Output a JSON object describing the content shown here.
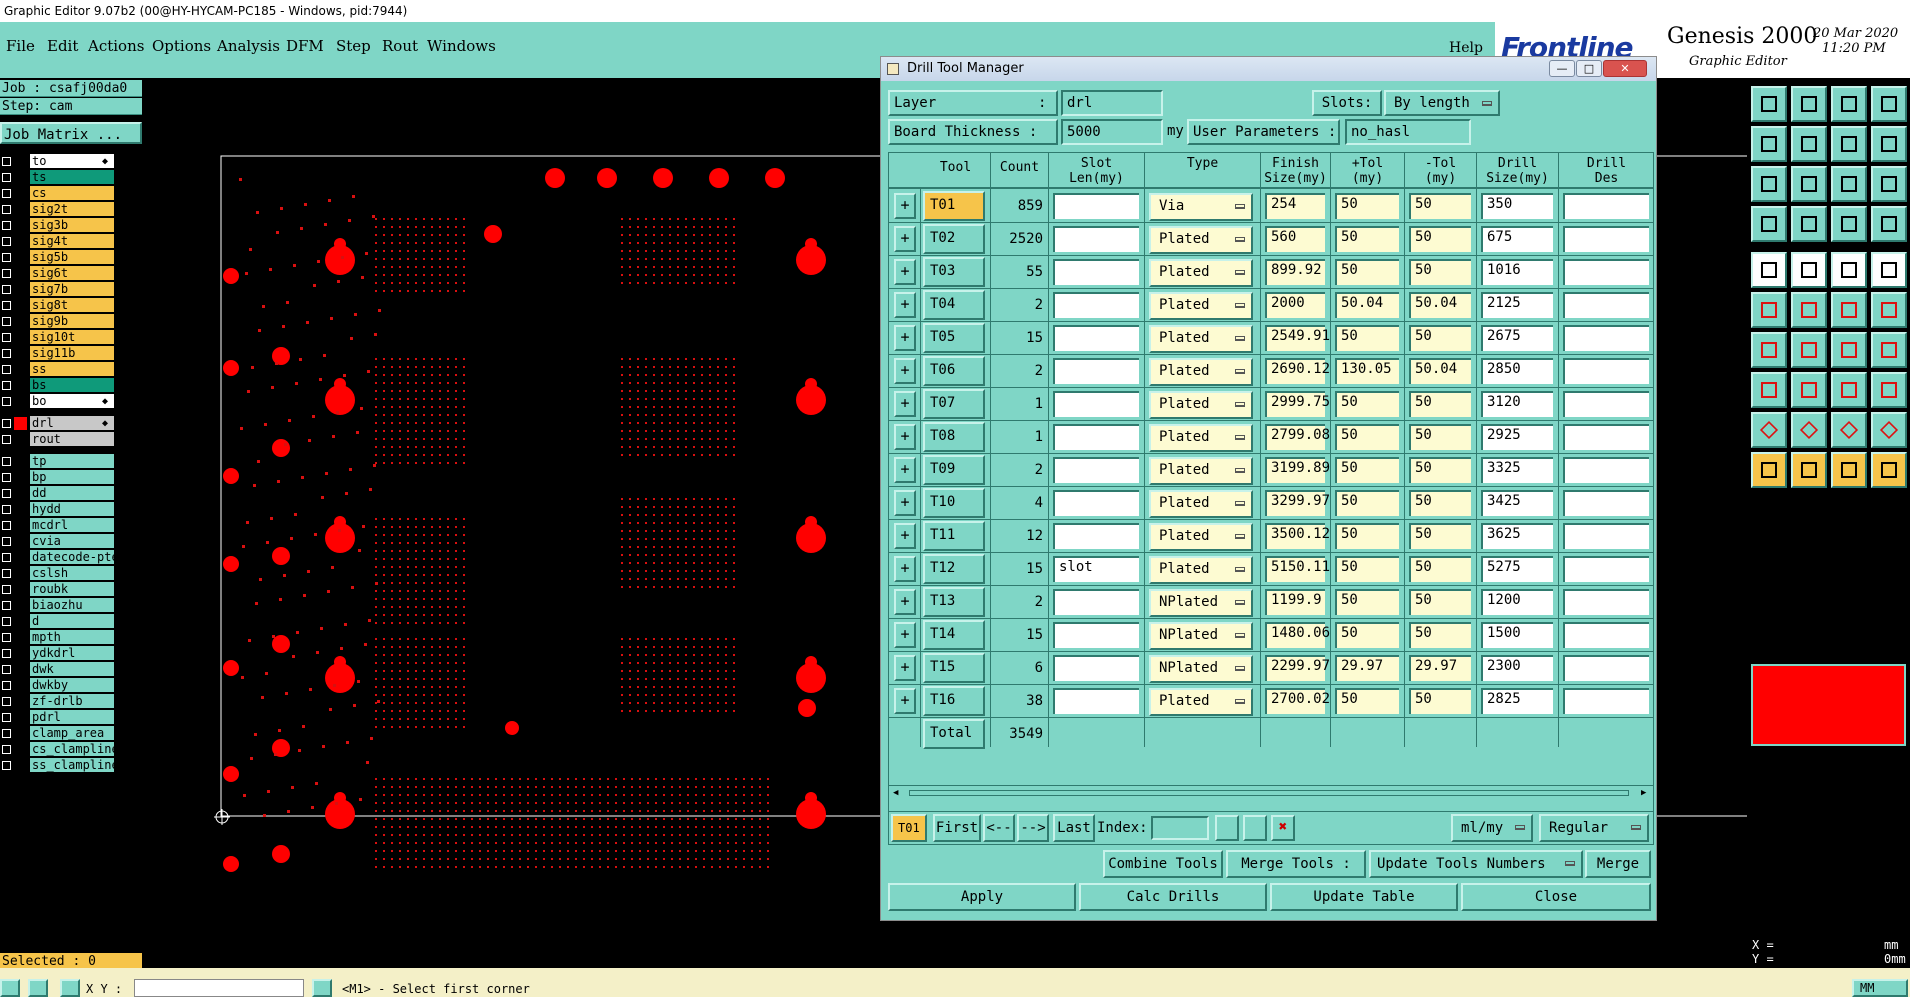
{
  "window": {
    "title": "Graphic Editor 9.07b2 (00@HY-HYCAM-PC185 - Windows, pid:7944)"
  },
  "menu": {
    "items": [
      "File",
      "Edit",
      "Actions",
      "Options",
      "Analysis",
      "DFM",
      "Step",
      "Rout",
      "Windows"
    ],
    "help": "Help"
  },
  "brand": {
    "logo": "Frontline",
    "product": "Genesis 2000",
    "subtitle": "Graphic Editor",
    "date": "20 Mar 2020",
    "time": "11:20 PM"
  },
  "job": {
    "job": "Job : csafj00da0",
    "step": "Step: cam",
    "matrix": "Job Matrix ..."
  },
  "layers_top": [
    {
      "name": "to",
      "bg": "#ffffff"
    },
    {
      "name": "ts",
      "bg": "#0f9a7a"
    },
    {
      "name": "cs",
      "bg": "#f6c44a"
    },
    {
      "name": "sig2t",
      "bg": "#f6c44a"
    },
    {
      "name": "sig3b",
      "bg": "#f6c44a"
    },
    {
      "name": "sig4t",
      "bg": "#f6c44a"
    },
    {
      "name": "sig5b",
      "bg": "#f6c44a"
    },
    {
      "name": "sig6t",
      "bg": "#f6c44a"
    },
    {
      "name": "sig7b",
      "bg": "#f6c44a"
    },
    {
      "name": "sig8t",
      "bg": "#f6c44a"
    },
    {
      "name": "sig9b",
      "bg": "#f6c44a"
    },
    {
      "name": "sig10t",
      "bg": "#f6c44a"
    },
    {
      "name": "sig11b",
      "bg": "#f6c44a"
    },
    {
      "name": "ss",
      "bg": "#f6c44a"
    },
    {
      "name": "bs",
      "bg": "#0f9a7a"
    },
    {
      "name": "bo",
      "bg": "#ffffff"
    }
  ],
  "layers_drill": [
    {
      "name": "drl",
      "bg": "#c8c8c8"
    },
    {
      "name": "rout",
      "bg": "#c8c8c8"
    }
  ],
  "layers_misc": [
    "tp",
    "bp",
    "dd",
    "hydd",
    "mcdrl",
    "cvia",
    "datecode-pte",
    "cslsh",
    "roubk",
    "biaozhu",
    "d",
    "mpth",
    "ydkdrl",
    "dwk",
    "dwkby",
    "zf-drlb",
    "pdrl",
    "clamp_area",
    "cs_clampline",
    "ss_clampline"
  ],
  "selected": "Selected : 0",
  "dialog": {
    "title": "Drill Tool Manager",
    "layer_label": "Layer",
    "layer_colon": ":",
    "layer_value": "drl",
    "slots_label": "Slots:",
    "slots_value": "By length",
    "board_thickness_label": "Board Thickness :",
    "board_thickness_value": "5000",
    "board_thickness_unit": "my",
    "user_params_label": "User Parameters :",
    "user_params_value": "no_hasl",
    "columns": [
      "Tool",
      "Count",
      "Slot\nLen(my)",
      "Type",
      "Finish\nSize(my)",
      "+Tol\n(my)",
      "-Tol\n(my)",
      "Drill\nSize(my)",
      "Drill\nDes"
    ],
    "rows": [
      {
        "tool": "T01",
        "count": "859",
        "slot": "",
        "type": "Via",
        "finish": "254",
        "ptol": "50",
        "mtol": "50",
        "drill": "350",
        "des": ""
      },
      {
        "tool": "T02",
        "count": "2520",
        "slot": "",
        "type": "Plated",
        "finish": "560",
        "ptol": "50",
        "mtol": "50",
        "drill": "675",
        "des": ""
      },
      {
        "tool": "T03",
        "count": "55",
        "slot": "",
        "type": "Plated",
        "finish": "899.92",
        "ptol": "50",
        "mtol": "50",
        "drill": "1016",
        "des": ""
      },
      {
        "tool": "T04",
        "count": "2",
        "slot": "",
        "type": "Plated",
        "finish": "2000",
        "ptol": "50.04",
        "mtol": "50.04",
        "drill": "2125",
        "des": ""
      },
      {
        "tool": "T05",
        "count": "15",
        "slot": "",
        "type": "Plated",
        "finish": "2549.91",
        "ptol": "50",
        "mtol": "50",
        "drill": "2675",
        "des": ""
      },
      {
        "tool": "T06",
        "count": "2",
        "slot": "",
        "type": "Plated",
        "finish": "2690.12",
        "ptol": "130.05",
        "mtol": "50.04",
        "drill": "2850",
        "des": ""
      },
      {
        "tool": "T07",
        "count": "1",
        "slot": "",
        "type": "Plated",
        "finish": "2999.75",
        "ptol": "50",
        "mtol": "50",
        "drill": "3120",
        "des": ""
      },
      {
        "tool": "T08",
        "count": "1",
        "slot": "",
        "type": "Plated",
        "finish": "2799.08",
        "ptol": "50",
        "mtol": "50",
        "drill": "2925",
        "des": ""
      },
      {
        "tool": "T09",
        "count": "2",
        "slot": "",
        "type": "Plated",
        "finish": "3199.89",
        "ptol": "50",
        "mtol": "50",
        "drill": "3325",
        "des": ""
      },
      {
        "tool": "T10",
        "count": "4",
        "slot": "",
        "type": "Plated",
        "finish": "3299.97",
        "ptol": "50",
        "mtol": "50",
        "drill": "3425",
        "des": ""
      },
      {
        "tool": "T11",
        "count": "12",
        "slot": "",
        "type": "Plated",
        "finish": "3500.12",
        "ptol": "50",
        "mtol": "50",
        "drill": "3625",
        "des": ""
      },
      {
        "tool": "T12",
        "count": "15",
        "slot": "slot",
        "type": "Plated",
        "finish": "5150.11",
        "ptol": "50",
        "mtol": "50",
        "drill": "5275",
        "des": ""
      },
      {
        "tool": "T13",
        "count": "2",
        "slot": "",
        "type": "NPlated",
        "finish": "1199.9",
        "ptol": "50",
        "mtol": "50",
        "drill": "1200",
        "des": ""
      },
      {
        "tool": "T14",
        "count": "15",
        "slot": "",
        "type": "NPlated",
        "finish": "1480.06",
        "ptol": "50",
        "mtol": "50",
        "drill": "1500",
        "des": ""
      },
      {
        "tool": "T15",
        "count": "6",
        "slot": "",
        "type": "NPlated",
        "finish": "2299.97",
        "ptol": "29.97",
        "mtol": "29.97",
        "drill": "2300",
        "des": ""
      },
      {
        "tool": "T16",
        "count": "38",
        "slot": "",
        "type": "Plated",
        "finish": "2700.02",
        "ptol": "50",
        "mtol": "50",
        "drill": "2825",
        "des": ""
      }
    ],
    "total_label": "Total",
    "total_value": "3549",
    "nav": {
      "current": "T01",
      "first": "First",
      "prev": "<--",
      "next": "-->",
      "last": "Last",
      "index_label": "Index:",
      "units": "ml/my",
      "mode": "Regular"
    },
    "buttons": {
      "combine": "Combine Tools",
      "merge_label": "Merge Tools :",
      "update_numbers": "Update Tools Numbers",
      "merge": "Merge",
      "apply": "Apply",
      "calc": "Calc Drills",
      "update_table": "Update Table",
      "close": "Close"
    }
  },
  "coords": {
    "x_label": "X =",
    "y_label": "Y =",
    "x_unit": "mm",
    "y_unit": "0mm"
  },
  "statusbar": {
    "xy_label": "X Y :",
    "prompt": "<M1> - Select first corner",
    "mode": "MM"
  },
  "colors": {
    "teal": "#7fd6c6",
    "yellow_cell": "#fdfbd2",
    "tool_btn": "#f6c44a",
    "pad_red": "#ff0000",
    "board_outline": "#ffffff"
  }
}
